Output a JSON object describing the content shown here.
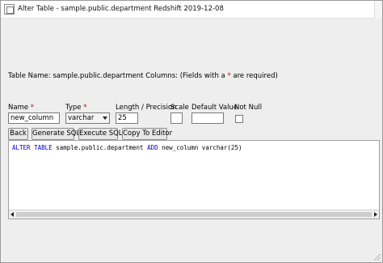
{
  "window": {
    "title": "Alter Table - sample.public.department Redshift 2019-12-08",
    "icon": "window-icon"
  },
  "table_info": {
    "prefix": "Table Name: sample.public.department  Columns: (Fields with a ",
    "asterisk": "*",
    "suffix": " are required)"
  },
  "columns": {
    "name": {
      "label": "Name ",
      "required_mark": "*",
      "value": "new_column"
    },
    "type": {
      "label": "Type ",
      "required_mark": "*",
      "value": "varchar"
    },
    "length_precision": {
      "label": "Length / Precision",
      "value": "25"
    },
    "scale": {
      "label": "Scale",
      "value": ""
    },
    "default_value": {
      "label": "Default Value",
      "value": ""
    },
    "not_null": {
      "label": "Not Null",
      "checked": false
    }
  },
  "buttons": {
    "back": "Back",
    "generate_sql": "Generate SQL",
    "execute_sql": "Execute SQL",
    "copy_to_editor": "Copy To Editor"
  },
  "sql": {
    "kw1": "ALTER TABLE",
    "t1": " sample.public.department ",
    "kw2": "ADD",
    "t2": " new_column varchar(25)"
  },
  "colors": {
    "keyword": "#0000cc",
    "required": "#d00000"
  }
}
